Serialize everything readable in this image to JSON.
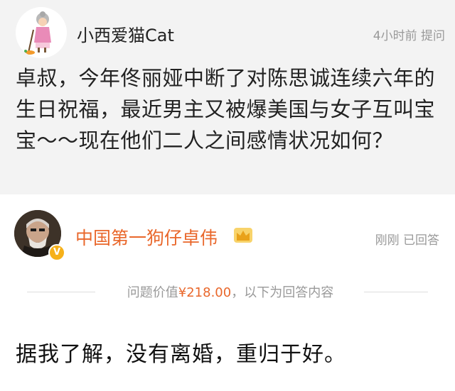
{
  "question": {
    "user": {
      "name": "小西爱猫Cat"
    },
    "time": "4小时前",
    "ask_label": "提问",
    "text": "卓叔，今年佟丽娅中断了对陈思诚连续六年的生日祝福，最近男主又被爆美国与女子互叫宝宝～～现在他们二人之间感情状况如何？"
  },
  "answer": {
    "user": {
      "name": "中国第一狗仔卓伟",
      "badge": "V"
    },
    "time": "刚刚",
    "answered_label": "已回答",
    "price_prefix": "问题价值",
    "price": "¥218.00",
    "price_suffix": "，以下为回答内容",
    "text": "据我了解，没有离婚，重归于好。"
  },
  "colors": {
    "accent": "#e9672b",
    "question_bg": "#f3f3f3",
    "meta": "#999999",
    "badge": "#f6b11a"
  }
}
